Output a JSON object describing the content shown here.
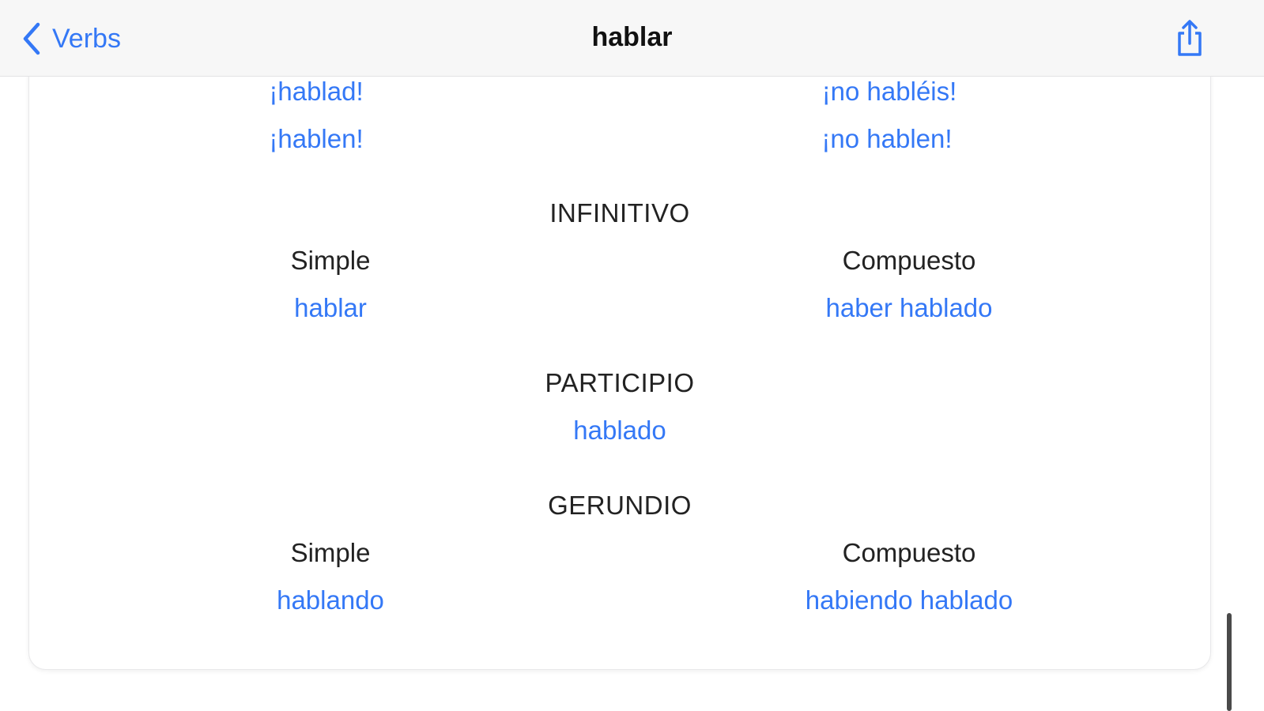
{
  "navbar": {
    "back_label": "Verbs",
    "title": "hablar",
    "back_icon": "chevron-left-icon",
    "share_icon": "share-icon"
  },
  "imperative": {
    "affirmative": [
      "¡hablad!",
      "¡hablen!"
    ],
    "negative": [
      "¡no habléis!",
      "¡no hablen!"
    ]
  },
  "infinitivo": {
    "heading": "INFINITIVO",
    "simple_label": "Simple",
    "simple_value": "hablar",
    "compuesto_label": "Compuesto",
    "compuesto_value": "haber hablado"
  },
  "participio": {
    "heading": "PARTICIPIO",
    "value": "hablado"
  },
  "gerundio": {
    "heading": "GERUNDIO",
    "simple_label": "Simple",
    "simple_value": "hablando",
    "compuesto_label": "Compuesto",
    "compuesto_value": "habiendo hablado"
  },
  "colors": {
    "accent": "#3478f6",
    "text": "#222222",
    "navbar_bg": "#f7f7f7"
  }
}
